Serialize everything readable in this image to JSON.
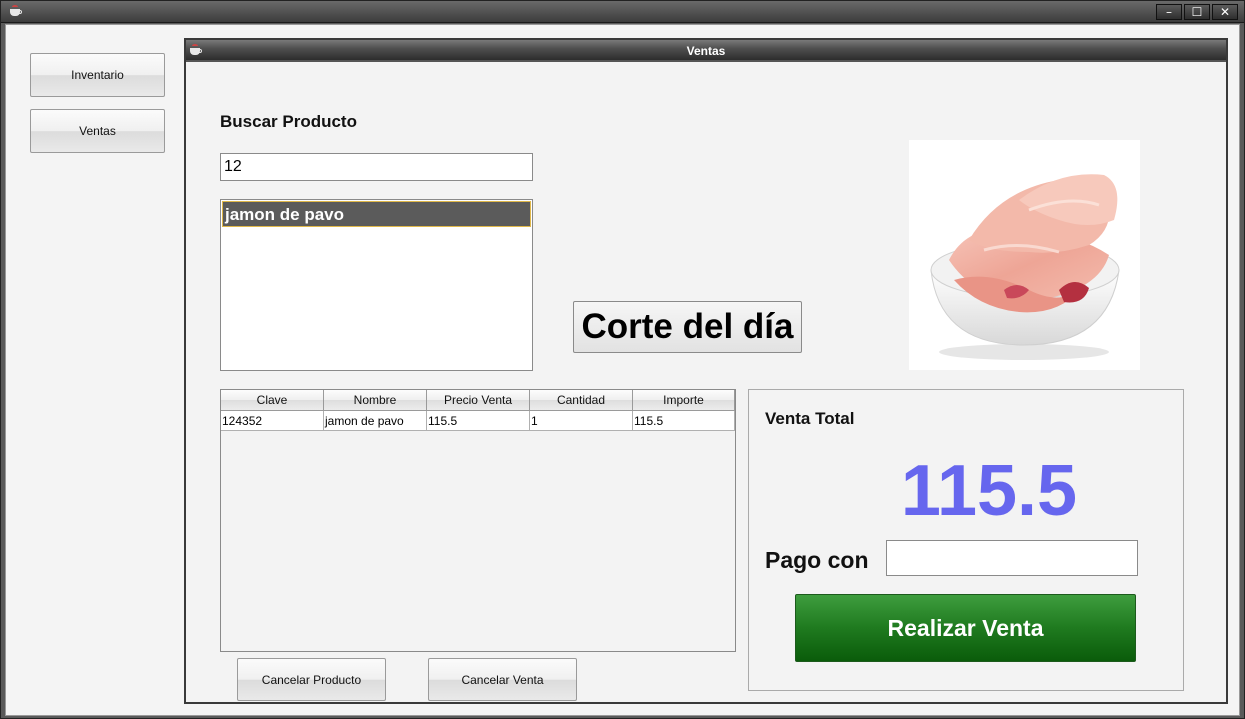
{
  "outer_window": {
    "controls": {
      "minimize": "–",
      "maximize": "☐",
      "close": "✕"
    }
  },
  "sidebar": {
    "items": [
      {
        "label": "Inventario"
      },
      {
        "label": "Ventas"
      }
    ]
  },
  "inner_window": {
    "title": "Ventas"
  },
  "search": {
    "label": "Buscar Producto",
    "value": "12",
    "results": [
      "jamon de pavo"
    ],
    "selected_index": 0
  },
  "corte_button": {
    "label": "Corte del día"
  },
  "product_image": {
    "alt": "sliced ham in white bowl"
  },
  "sales_table": {
    "columns": [
      "Clave",
      "Nombre",
      "Precio Venta",
      "Cantidad",
      "Importe"
    ],
    "rows": [
      [
        "124352",
        "jamon de pavo",
        "115.5",
        "1",
        "115.5"
      ]
    ]
  },
  "actions": {
    "cancel_product": "Cancelar Producto",
    "cancel_sale": "Cancelar Venta"
  },
  "total_panel": {
    "label": "Venta Total",
    "value": "115.5",
    "value_color": "#6666ee",
    "pay_label": "Pago con",
    "pay_value": "",
    "submit_label": "Realizar Venta",
    "submit_color": "#1f7a1f"
  }
}
